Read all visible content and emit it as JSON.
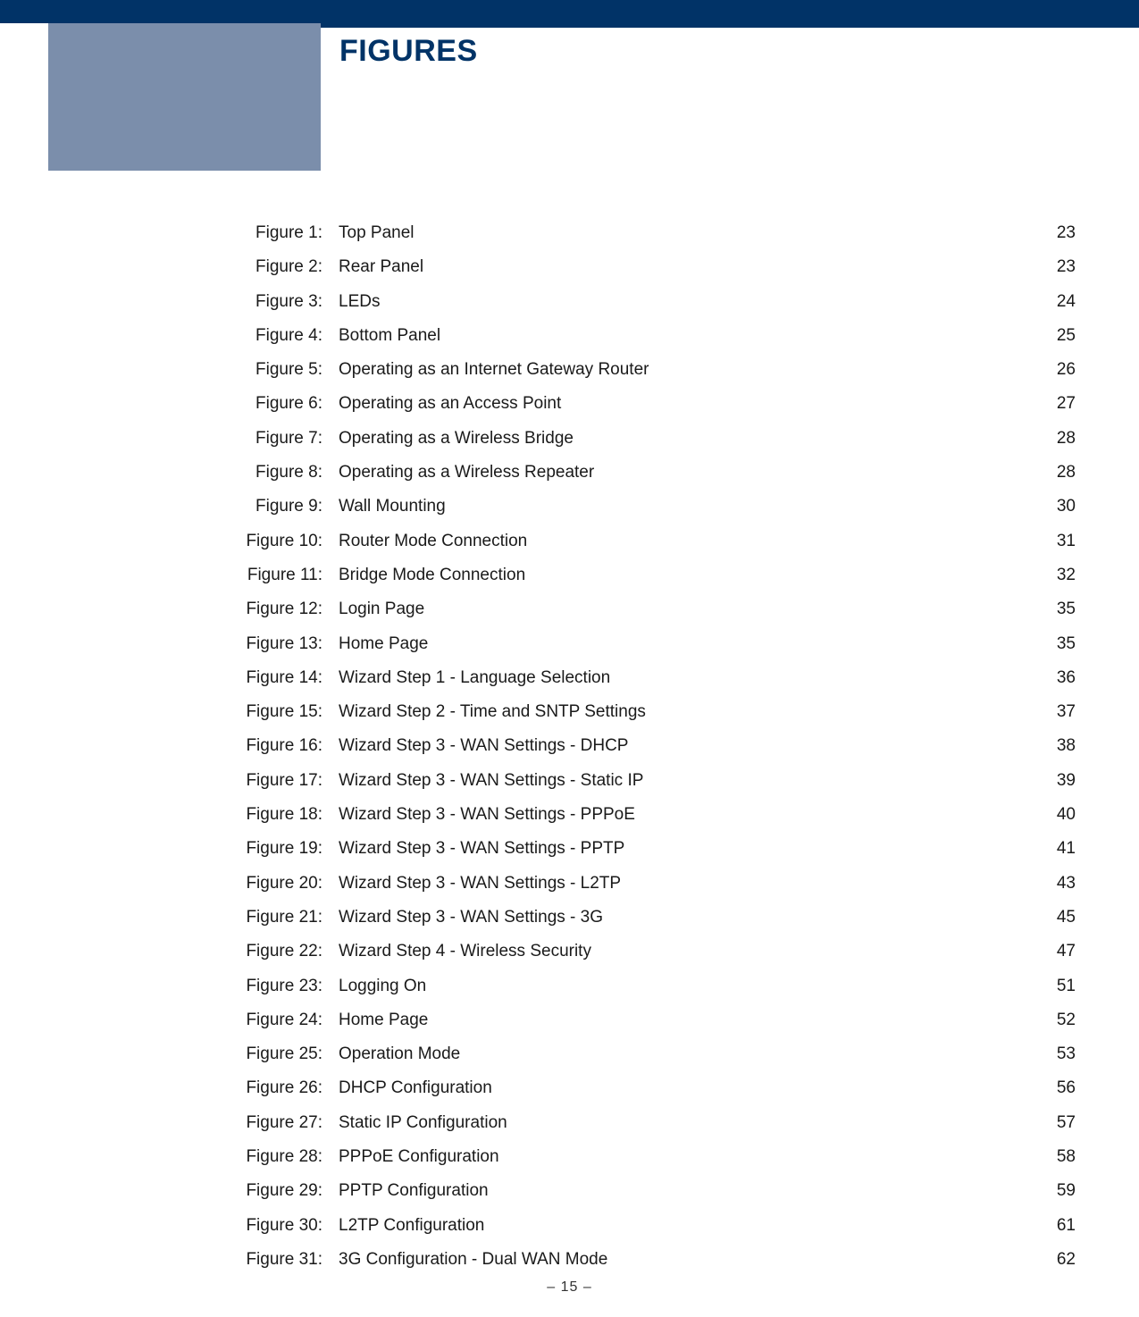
{
  "heading": "FIGURES",
  "page_footer": "–  15  –",
  "figures": [
    {
      "label": "Figure 1:",
      "title": "Top Panel",
      "page": "23"
    },
    {
      "label": "Figure 2:",
      "title": "Rear Panel",
      "page": "23"
    },
    {
      "label": "Figure 3:",
      "title": "LEDs",
      "page": "24"
    },
    {
      "label": "Figure 4:",
      "title": "Bottom Panel",
      "page": "25"
    },
    {
      "label": "Figure 5:",
      "title": "Operating as an Internet Gateway Router",
      "page": "26"
    },
    {
      "label": "Figure 6:",
      "title": "Operating as an Access Point",
      "page": "27"
    },
    {
      "label": "Figure 7:",
      "title": "Operating as a Wireless Bridge",
      "page": "28"
    },
    {
      "label": "Figure 8:",
      "title": "Operating as a Wireless Repeater",
      "page": "28"
    },
    {
      "label": "Figure 9:",
      "title": "Wall Mounting",
      "page": "30"
    },
    {
      "label": "Figure 10:",
      "title": "Router Mode Connection",
      "page": "31"
    },
    {
      "label": "Figure 11:",
      "title": "Bridge Mode Connection",
      "page": "32"
    },
    {
      "label": "Figure 12:",
      "title": "Login Page",
      "page": "35"
    },
    {
      "label": "Figure 13:",
      "title": "Home Page",
      "page": "35"
    },
    {
      "label": "Figure 14:",
      "title": "Wizard Step 1 - Language Selection",
      "page": "36"
    },
    {
      "label": "Figure 15:",
      "title": "Wizard Step 2 - Time and SNTP Settings",
      "page": "37"
    },
    {
      "label": "Figure 16:",
      "title": "Wizard Step 3 - WAN Settings - DHCP",
      "page": "38"
    },
    {
      "label": "Figure 17:",
      "title": "Wizard Step 3 - WAN Settings - Static IP",
      "page": "39"
    },
    {
      "label": "Figure 18:",
      "title": "Wizard Step 3 - WAN Settings - PPPoE",
      "page": "40"
    },
    {
      "label": "Figure 19:",
      "title": "Wizard Step 3 - WAN Settings - PPTP",
      "page": "41"
    },
    {
      "label": "Figure 20:",
      "title": "Wizard Step 3 - WAN Settings - L2TP",
      "page": "43"
    },
    {
      "label": "Figure 21:",
      "title": "Wizard Step 3 - WAN Settings - 3G",
      "page": "45"
    },
    {
      "label": "Figure 22:",
      "title": "Wizard Step 4 - Wireless Security",
      "page": "47"
    },
    {
      "label": "Figure 23:",
      "title": "Logging On",
      "page": "51"
    },
    {
      "label": "Figure 24:",
      "title": "Home Page",
      "page": "52"
    },
    {
      "label": "Figure 25:",
      "title": "Operation Mode",
      "page": "53"
    },
    {
      "label": "Figure 26:",
      "title": "DHCP Configuration",
      "page": "56"
    },
    {
      "label": "Figure 27:",
      "title": "Static IP Configuration",
      "page": "57"
    },
    {
      "label": "Figure 28:",
      "title": "PPPoE Configuration",
      "page": "58"
    },
    {
      "label": "Figure 29:",
      "title": "PPTP Configuration",
      "page": "59"
    },
    {
      "label": "Figure 30:",
      "title": "L2TP Configuration",
      "page": "61"
    },
    {
      "label": "Figure 31:",
      "title": "3G Configuration - Dual WAN Mode",
      "page": "62"
    }
  ]
}
